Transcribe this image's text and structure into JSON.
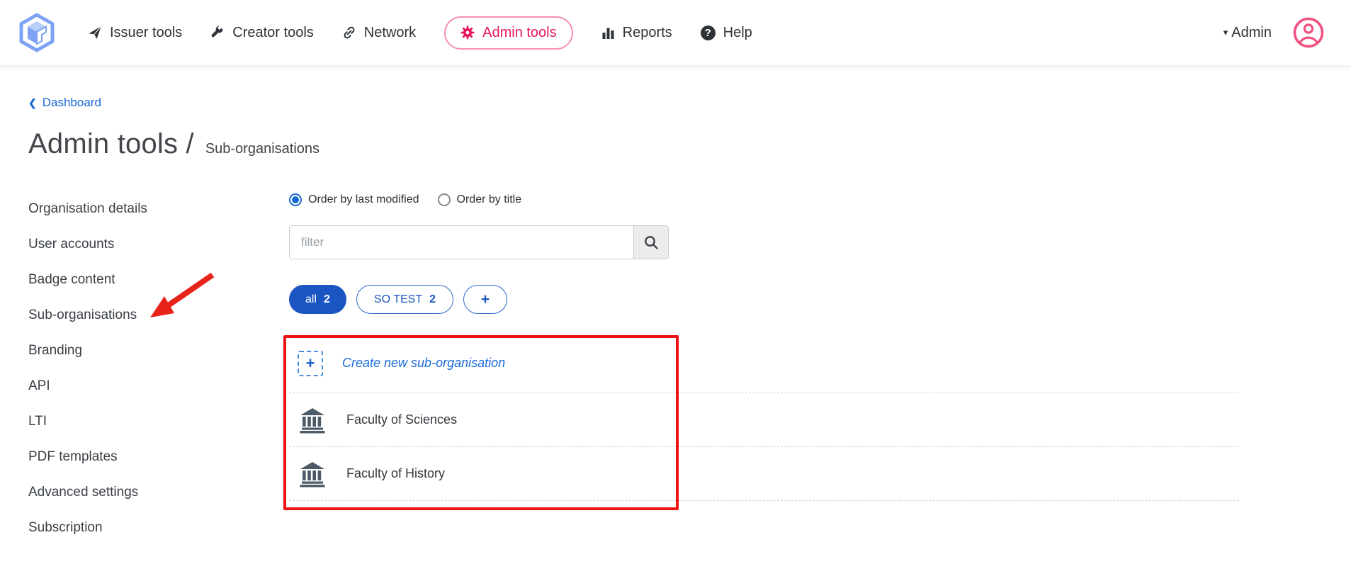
{
  "nav": {
    "items": [
      {
        "label": "Issuer tools",
        "icon": "paper-plane-icon"
      },
      {
        "label": "Creator tools",
        "icon": "wrench-icon"
      },
      {
        "label": "Network",
        "icon": "link-icon"
      },
      {
        "label": "Admin tools",
        "icon": "gear-icon",
        "active": true
      },
      {
        "label": "Reports",
        "icon": "bar-chart-icon"
      },
      {
        "label": "Help",
        "icon": "help-icon"
      }
    ],
    "user_label": "Admin"
  },
  "icons": {
    "help_glyph": "?",
    "caret_glyph": "▾",
    "back_chevron_glyph": "❮",
    "plus_glyph": "+"
  },
  "breadcrumb": {
    "label": "Dashboard"
  },
  "page_title": {
    "main": "Admin tools /",
    "sub": "Sub-organisations"
  },
  "sidebar": {
    "items": [
      "Organisation details",
      "User accounts",
      "Badge content",
      "Sub-organisations",
      "Branding",
      "API",
      "LTI",
      "PDF templates",
      "Advanced settings",
      "Subscription"
    ]
  },
  "main": {
    "order_options": [
      {
        "label": "Order by last modified",
        "selected": true
      },
      {
        "label": "Order by title",
        "selected": false
      }
    ],
    "filter": {
      "placeholder": "filter",
      "value": ""
    },
    "tags": [
      {
        "label": "all",
        "count": "2",
        "active": true
      },
      {
        "label": "SO TEST",
        "count": "2",
        "active": false
      },
      {
        "label": "+",
        "add": true
      }
    ],
    "list": {
      "create_label": "Create new sub-organisation",
      "items": [
        {
          "label": "Faculty of Sciences",
          "icon": "bank-icon"
        },
        {
          "label": "Faculty of History",
          "icon": "bank-icon"
        }
      ]
    }
  },
  "annotations": {
    "highlight_box": "red rectangle around sub-organisation list",
    "arrow": "red arrow pointing to Sub-organisations sidebar item"
  },
  "colors": {
    "accent_blue": "#1b55c2",
    "link_blue": "#1a6bd8",
    "crimson": "#e8175d",
    "annotation_red": "#ee1111",
    "bank_gray": "#4d5b69"
  }
}
